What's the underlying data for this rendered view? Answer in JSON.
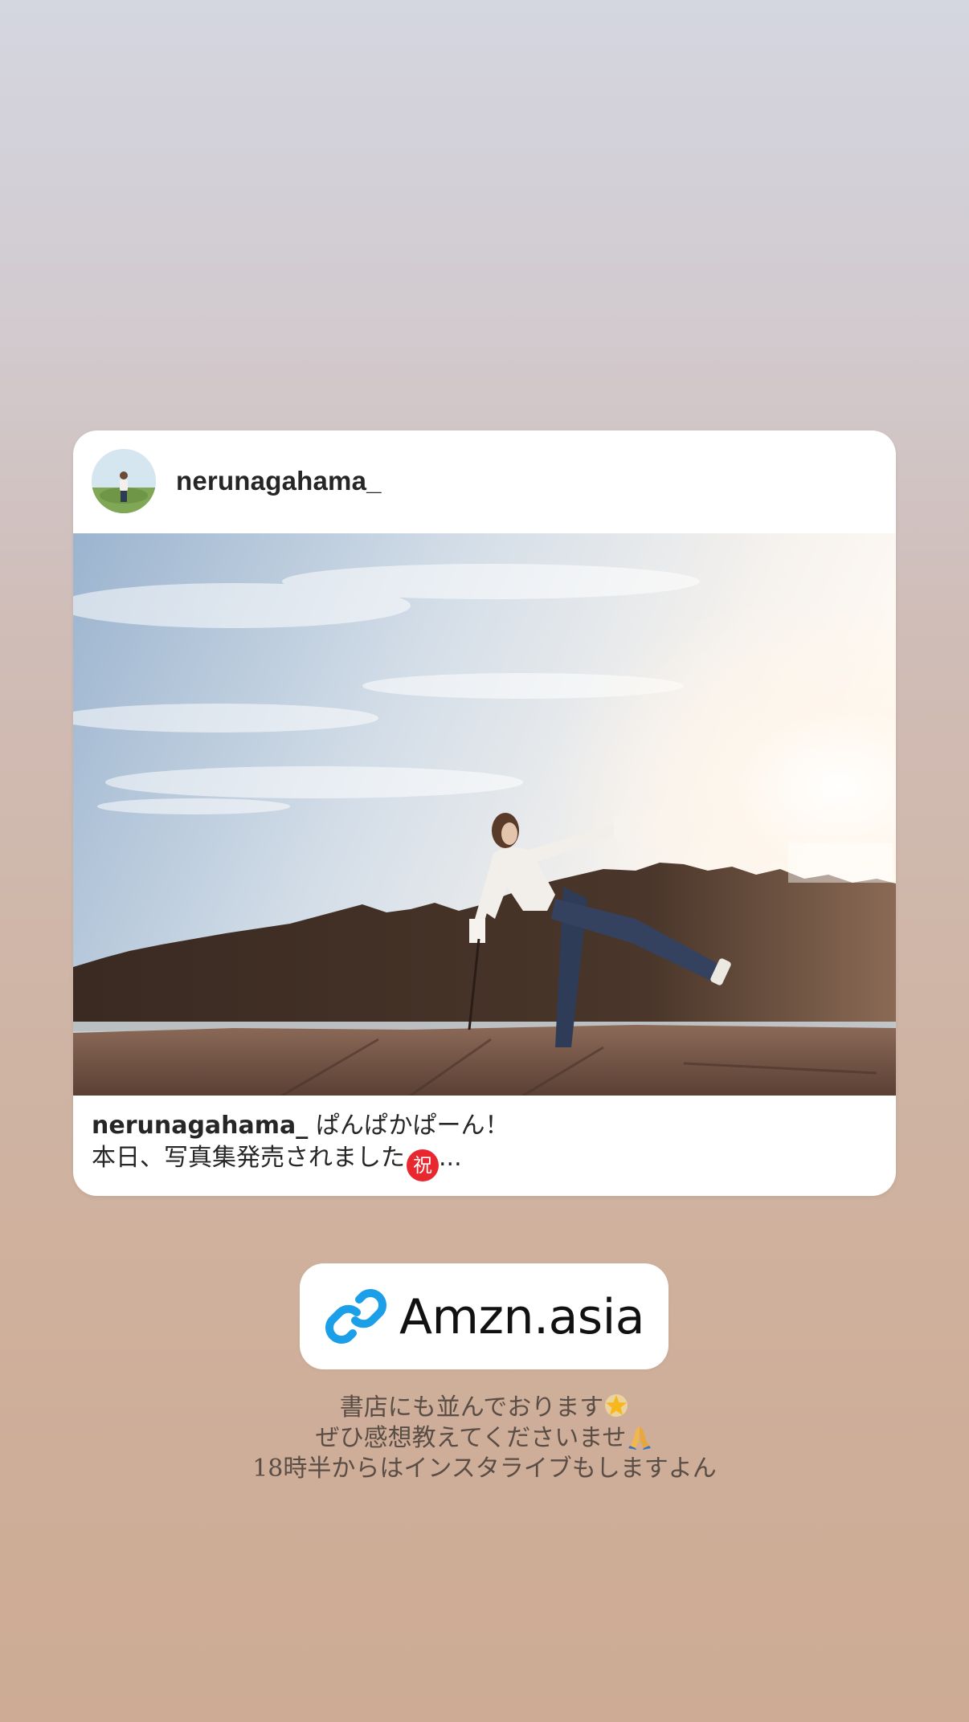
{
  "post": {
    "username": "nerunagahama_",
    "caption_user": "nerunagahama_",
    "caption_line1": "ぱんぱかぱーん！",
    "caption_line2": "本日、写真集発売されました",
    "caption_badge": "祝",
    "caption_ellipsis": "..."
  },
  "link_sticker": {
    "label": "Amzn.asia"
  },
  "story_text": {
    "line1": "書店にも並んでおります",
    "line2": "ぜひ感想教えてくださいませ",
    "line3": "18時半からはインスタライブもしますよん"
  },
  "icons": {
    "link": "link-icon",
    "star": "glowing-star-icon",
    "hands": "folded-hands-icon"
  },
  "colors": {
    "link_icon": "#1a9fe8",
    "badge_red": "#e8272f"
  }
}
